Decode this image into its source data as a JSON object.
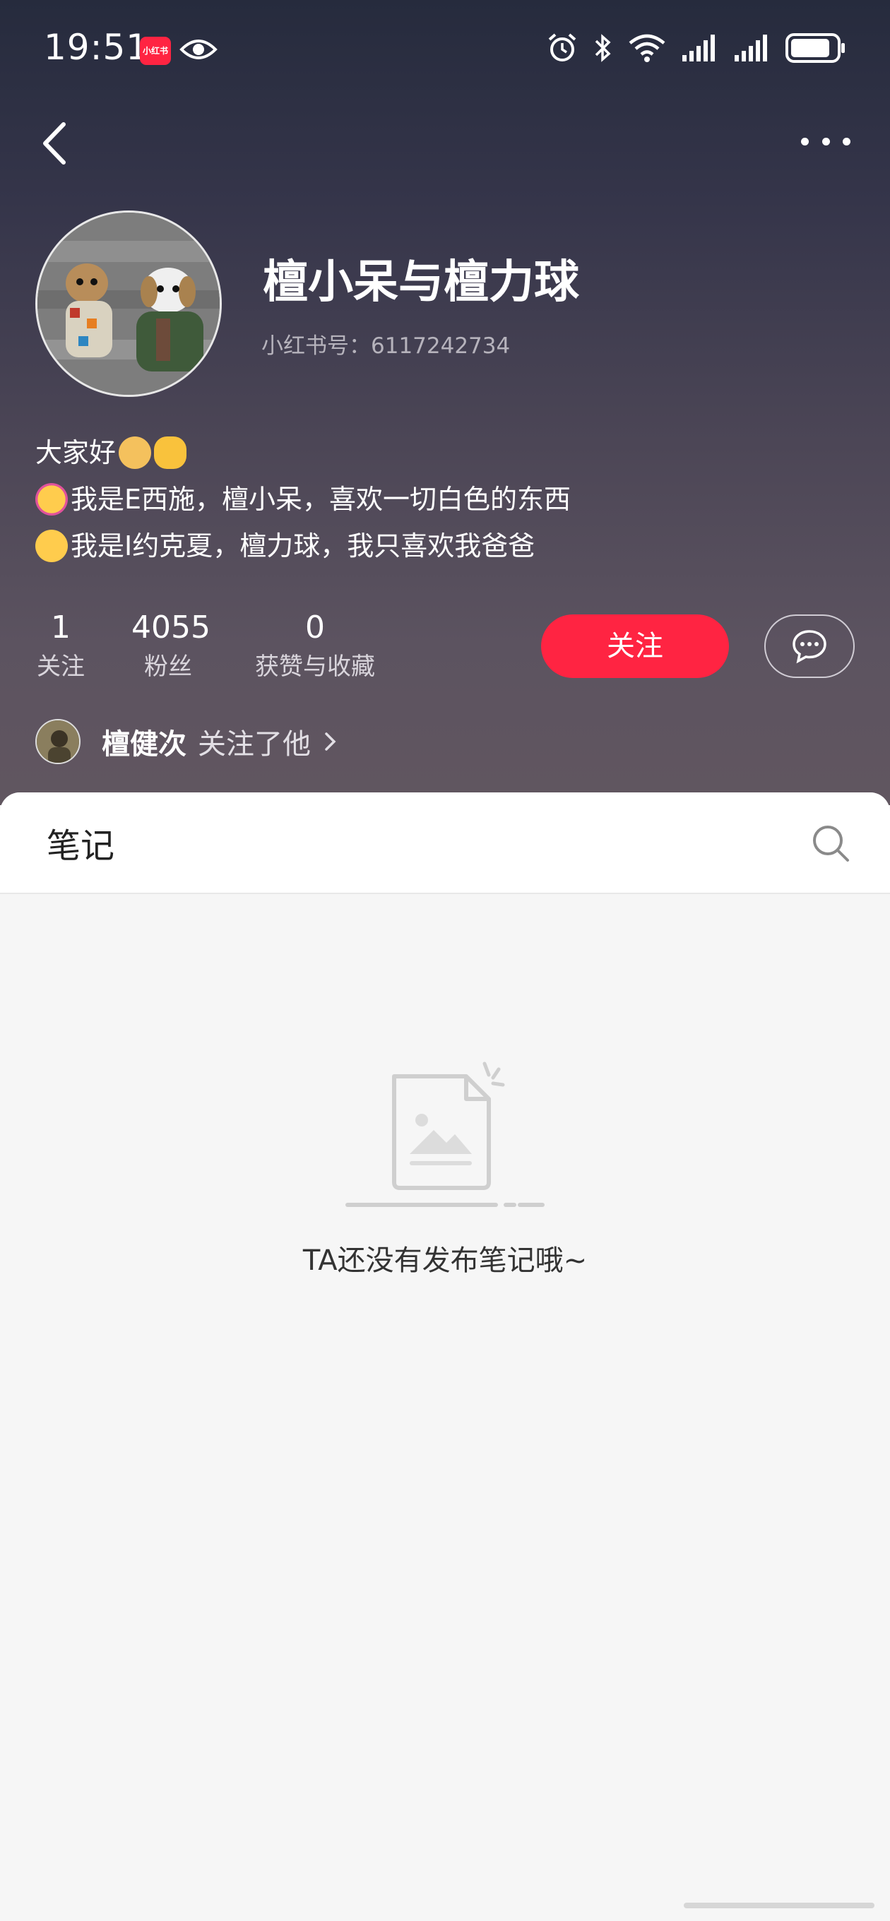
{
  "status_bar": {
    "time": "19:51",
    "app_badge": "小红书",
    "icons": [
      "eye-icon",
      "alarm-icon",
      "bluetooth-icon",
      "wifi-icon",
      "signal-icon",
      "signal-icon",
      "battery-icon"
    ]
  },
  "nav": {
    "back_icon": "chevron-left-icon",
    "more_icon": "more-dots-icon"
  },
  "profile": {
    "name": "檀小呆与檀力球",
    "red_id_label": "小红书号：",
    "red_id": "6117242734",
    "bio": [
      {
        "text": "大家好",
        "emojis": [
          "person-raising-hand-emoji",
          "waving-hand-emoji"
        ]
      },
      {
        "emoji": "partying-face-emoji",
        "text": "我是E西施，檀小呆，喜欢一切白色的东西"
      },
      {
        "emoji": "pleading-face-emoji",
        "text": "我是I约克夏，檀力球，我只喜欢我爸爸"
      }
    ],
    "stats": [
      {
        "num": "1",
        "label": "关注"
      },
      {
        "num": "4055",
        "label": "粉丝"
      },
      {
        "num": "0",
        "label": "获赞与收藏"
      }
    ],
    "follow_label": "关注",
    "message_icon": "chat-bubble-icon",
    "mutual": {
      "name": "檀健次",
      "text": "关注了他"
    }
  },
  "tabs": {
    "notes_label": "笔记",
    "search_icon": "search-icon"
  },
  "empty_state": {
    "text": "TA还没有发布笔记哦~"
  },
  "colors": {
    "accent": "#ff2442",
    "header_top": "#262b3d",
    "header_bottom": "#615660"
  }
}
